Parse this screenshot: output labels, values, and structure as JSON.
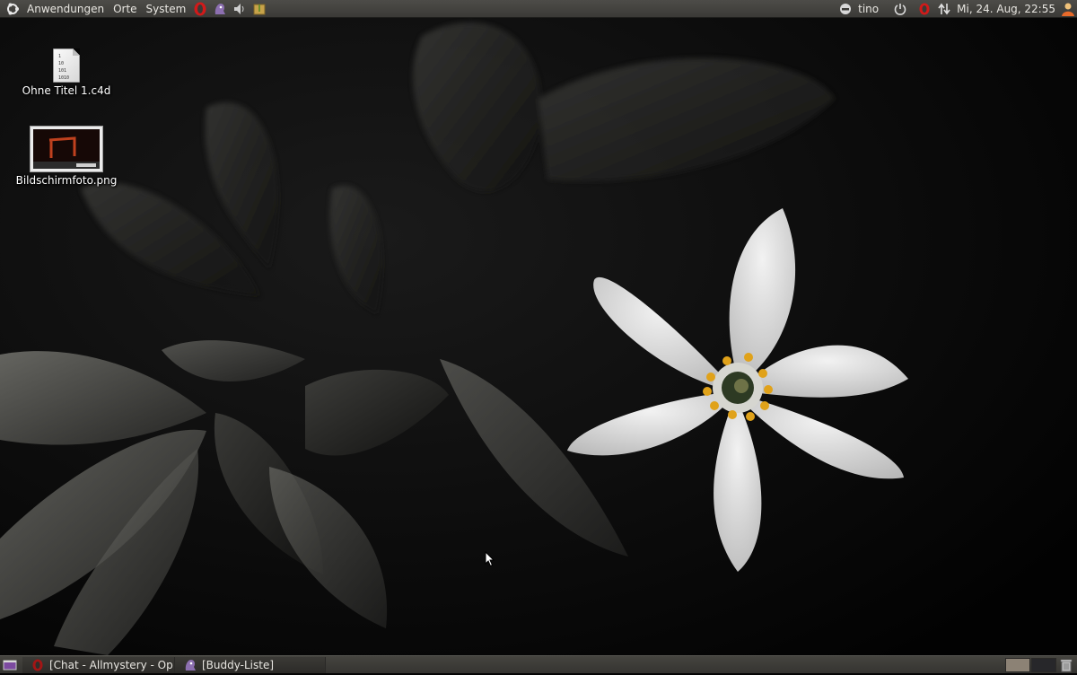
{
  "top_panel": {
    "menus": [
      "Anwendungen",
      "Orte",
      "System"
    ],
    "user": "tino",
    "datetime": "Mi, 24. Aug, 22:55",
    "launcher_icons": [
      "opera-icon",
      "pidgin-icon",
      "volume-icon",
      "archive-manager-icon"
    ],
    "tray_icons": [
      "chat-status-icon",
      "power-icon",
      "opera-mail-icon",
      "network-icon",
      "user-icon"
    ]
  },
  "desktop": {
    "icons": [
      {
        "label": "Ohne Titel 1.c4d",
        "type": "binary-file-icon",
        "glyph_lines": [
          "1",
          "10",
          "101",
          "1010"
        ]
      },
      {
        "label": "Bildschirmfoto.png",
        "type": "image-thumbnail-icon"
      }
    ]
  },
  "taskbar": {
    "tasks": [
      {
        "label": "[Chat - Allmystery - Op...",
        "icon": "opera-icon"
      },
      {
        "label": "[Buddy-Liste]",
        "icon": "pidgin-icon"
      }
    ],
    "workspaces": 2,
    "active_workspace": 1
  },
  "colors": {
    "panel": "#3b3a37",
    "flower_center": "#e0a21a",
    "workspace_active": "#8c8275"
  }
}
